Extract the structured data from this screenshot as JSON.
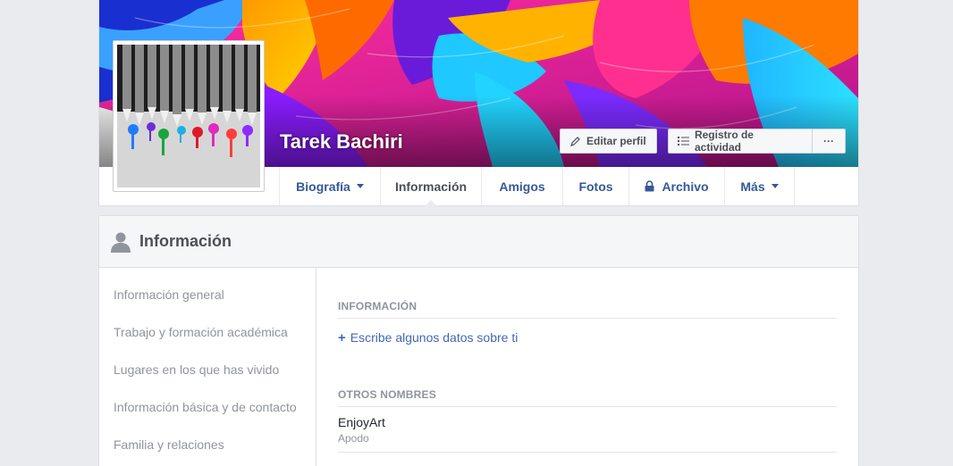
{
  "profile": {
    "name": "Tarek Bachiri",
    "edit_button": "Editar perfil",
    "activity_log_button": "Registro de actividad",
    "more_button": "···"
  },
  "tabs": [
    {
      "label": "Biografía",
      "dropdown": true
    },
    {
      "label": "Información",
      "active": true
    },
    {
      "label": "Amigos"
    },
    {
      "label": "Fotos"
    },
    {
      "label": "Archivo",
      "locked": true
    },
    {
      "label": "Más",
      "dropdown": true
    }
  ],
  "about": {
    "title": "Información",
    "nav": [
      "Información general",
      "Trabajo y formación académica",
      "Lugares en los que has vivido",
      "Información básica y de contacto",
      "Familia y relaciones"
    ],
    "sections": {
      "info_title": "INFORMACIÓN",
      "info_add_link": "Escribe algunos datos sobre ti",
      "other_names_title": "OTROS NOMBRES",
      "nickname": "EnjoyArt",
      "nickname_type": "Apodo"
    }
  },
  "colors": {
    "link": "#365899",
    "accent": "#4267b2",
    "muted": "#90949c",
    "background": "#e9ebee"
  },
  "icons": [
    "pencil-icon",
    "list-icon",
    "lock-icon",
    "person-icon",
    "caret-down-icon"
  ]
}
